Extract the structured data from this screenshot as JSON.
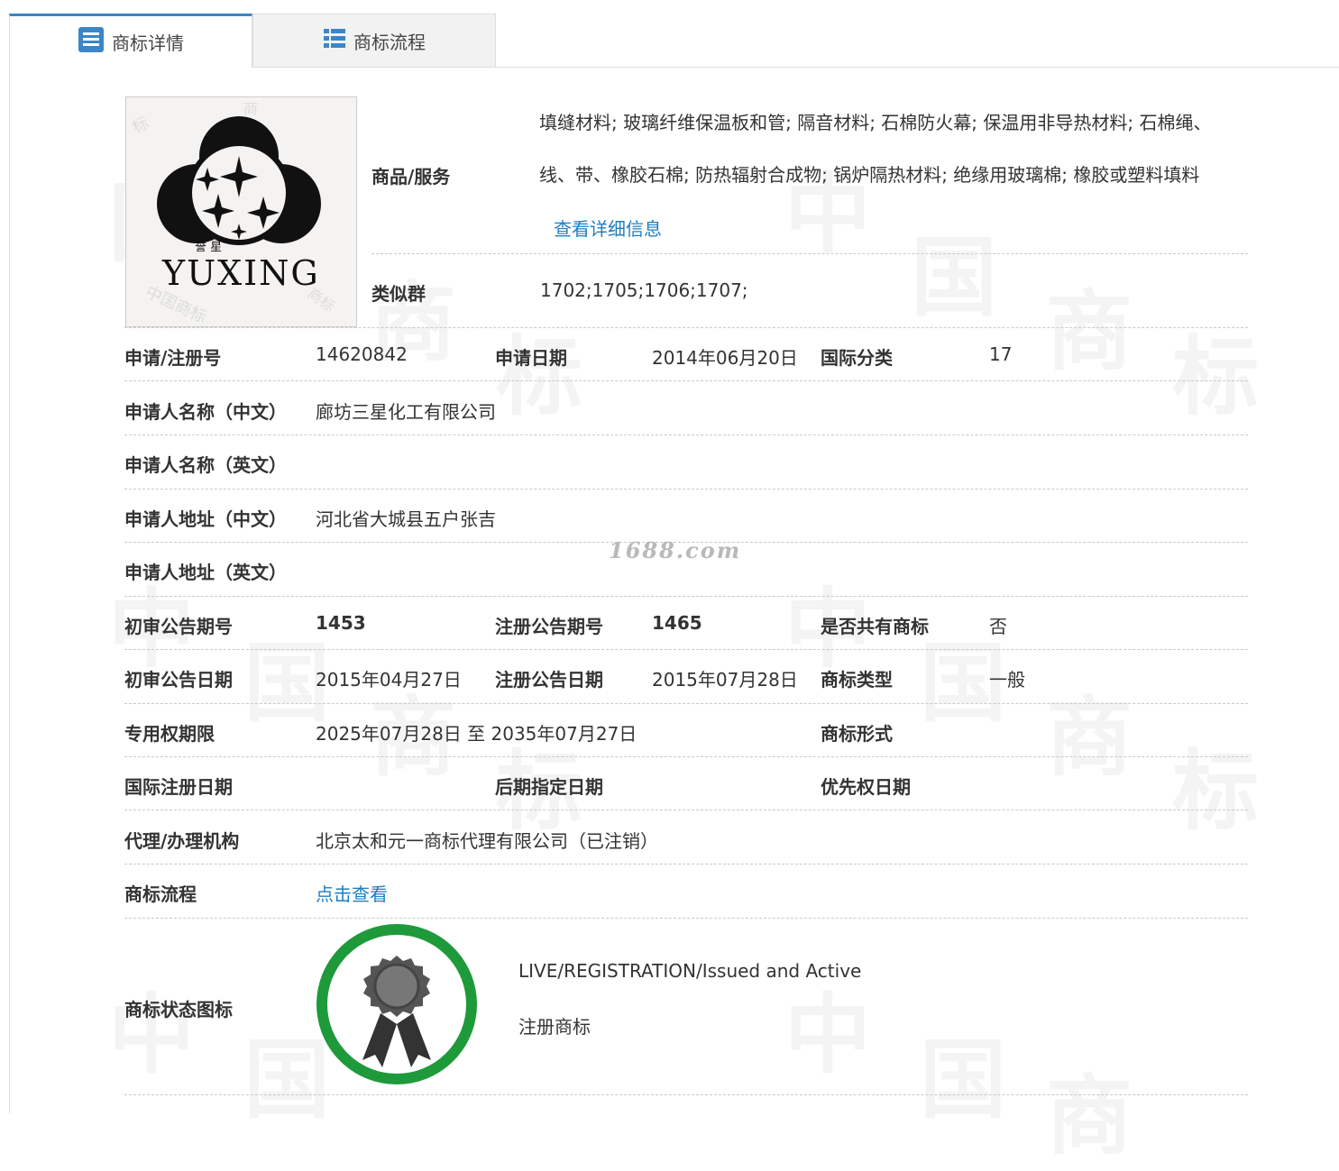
{
  "tabs": [
    {
      "label": "商标详情",
      "icon": "list-icon",
      "active": true
    },
    {
      "label": "商标流程",
      "icon": "grid-list-icon",
      "active": false
    }
  ],
  "logo": {
    "text": "YUXING",
    "chars": "誉 星"
  },
  "goods": {
    "label": "商品/服务",
    "line1": "填缝材料; 玻璃纤维保温板和管; 隔音材料; 石棉防火幕; 保温用非导热材料; 石棉绳、",
    "line2": "线、带、橡胶石棉; 防热辐射合成物; 锅炉隔热材料; 绝缘用玻璃棉; 橡胶或塑料填料",
    "more_link": "查看详细信息"
  },
  "similar": {
    "label": "类似群",
    "value": "1702;1705;1706;1707;"
  },
  "reg": {
    "no_label": "申请/注册号",
    "no_value": "14620842",
    "date_label": "申请日期",
    "date_value": "2014年06月20日",
    "class_label": "国际分类",
    "class_value": "17"
  },
  "applicant": {
    "name_cn_label": "申请人名称（中文）",
    "name_cn_value": "廊坊三星化工有限公司",
    "name_en_label": "申请人名称（英文）",
    "name_en_value": "",
    "addr_cn_label": "申请人地址（中文）",
    "addr_cn_value": "河北省大城县五户张吉",
    "addr_en_label": "申请人地址（英文）",
    "addr_en_value": ""
  },
  "watermark_site": "1688.com",
  "publication": {
    "prelim_no_label": "初审公告期号",
    "prelim_no_value": "1453",
    "reg_no_label": "注册公告期号",
    "reg_no_value": "1465",
    "shared_label": "是否共有商标",
    "shared_value": "否",
    "prelim_date_label": "初审公告日期",
    "prelim_date_value": "2015年04月27日",
    "reg_date_label": "注册公告日期",
    "reg_date_value": "2015年07月28日",
    "type_label": "商标类型",
    "type_value": "一般"
  },
  "rights": {
    "period_label": "专用权期限",
    "period_value": "2025年07月28日 至 2035年07月27日",
    "form_label": "商标形式",
    "form_value": ""
  },
  "intl": {
    "intl_date_label": "国际注册日期",
    "intl_date_value": "",
    "later_label": "后期指定日期",
    "later_value": "",
    "priority_label": "优先权日期",
    "priority_value": ""
  },
  "agent": {
    "label": "代理/办理机构",
    "value": "北京太和元一商标代理有限公司（已注销）"
  },
  "flow": {
    "label": "商标流程",
    "link": "点击查看"
  },
  "status": {
    "label": "商标状态图标",
    "en": "LIVE/REGISTRATION/Issued and Active",
    "cn": "注册商标",
    "ring_color": "#1e9a3a",
    "icon": "award-ribbon-icon"
  },
  "colors": {
    "accent": "#3a86c8",
    "link": "#1d7fc0"
  }
}
